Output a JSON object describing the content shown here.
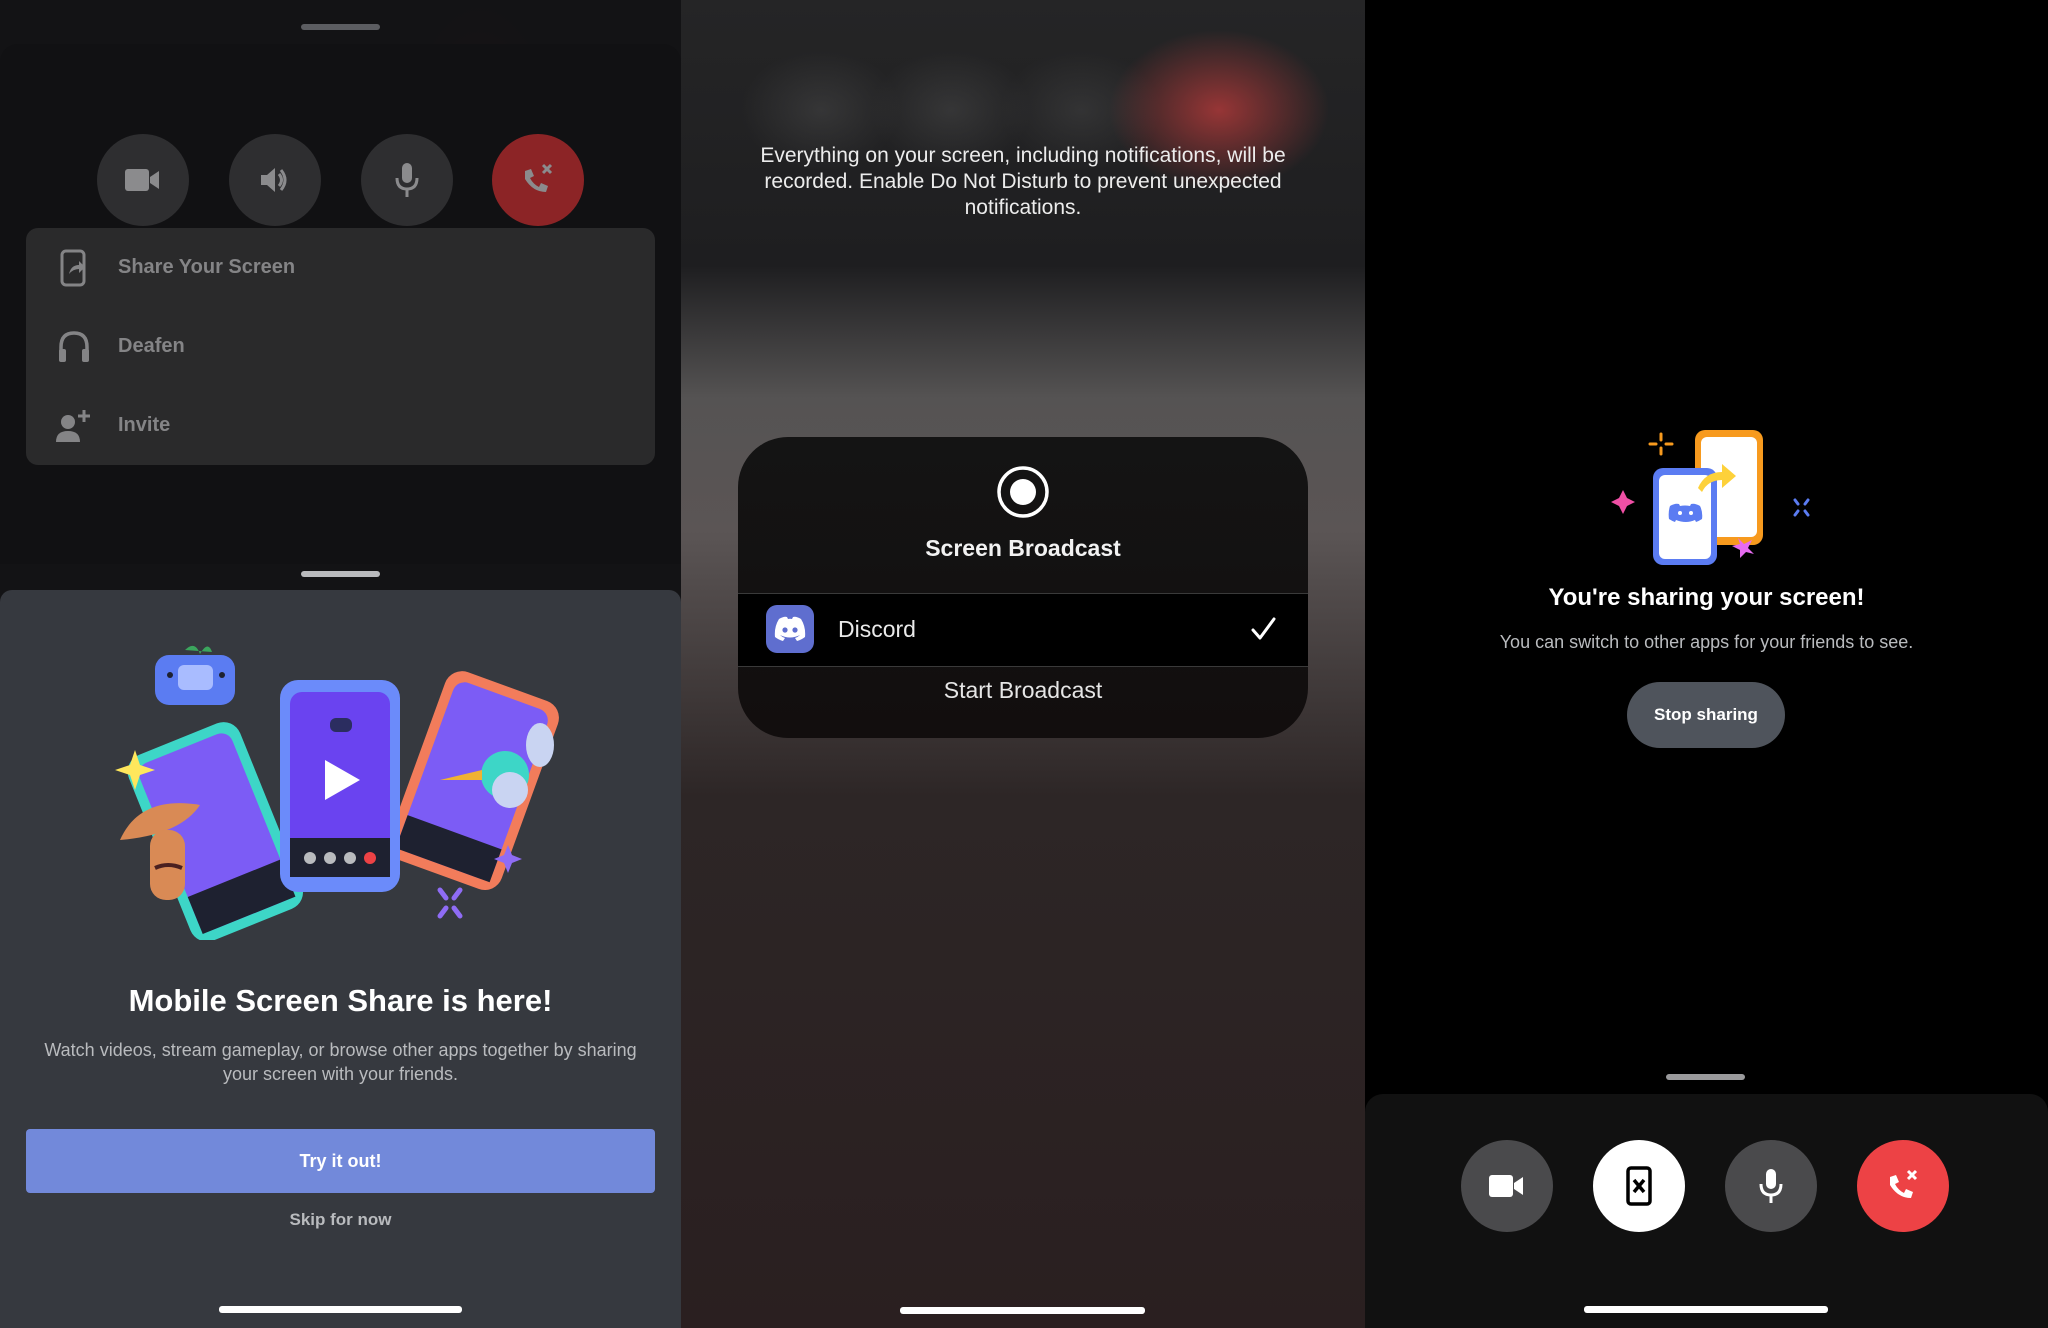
{
  "panel_call_menu": {
    "call_controls": [
      {
        "name": "camera",
        "icon": "video-camera-icon"
      },
      {
        "name": "speaker",
        "icon": "speaker-icon"
      },
      {
        "name": "microphone",
        "icon": "microphone-icon"
      },
      {
        "name": "disconnect",
        "icon": "end-call-icon"
      }
    ],
    "menu_items": [
      {
        "label": "Share Your Screen",
        "icon": "share-screen-icon"
      },
      {
        "label": "Deafen",
        "icon": "headphones-icon"
      },
      {
        "label": "Invite",
        "icon": "add-user-icon"
      }
    ],
    "promo": {
      "title": "Mobile Screen Share is here!",
      "description": "Watch videos, stream gameplay, or browse other apps together by sharing your screen with your friends.",
      "primary_button": "Try it out!",
      "secondary_button": "Skip for now"
    }
  },
  "panel_broadcast": {
    "warning": "Everything on your screen, including notifications, will be recorded. Enable Do Not Disturb to prevent unexpected notifications.",
    "dialog_title": "Screen Broadcast",
    "selected_app": "Discord",
    "selected": true,
    "start_button": "Start Broadcast"
  },
  "panel_sharing": {
    "title": "You're sharing your screen!",
    "description": "You can switch to other apps for your friends to see.",
    "stop_button": "Stop sharing",
    "call_controls": [
      {
        "name": "camera",
        "icon": "video-camera-icon"
      },
      {
        "name": "stop-screen-share",
        "icon": "stop-screen-share-icon"
      },
      {
        "name": "microphone",
        "icon": "microphone-icon"
      },
      {
        "name": "disconnect",
        "icon": "end-call-icon"
      }
    ]
  },
  "colors": {
    "blurple": "#7289da",
    "danger_red": "#ed4245",
    "sheet_bg": "#36393f",
    "stop_button_bg": "#4f545c"
  }
}
